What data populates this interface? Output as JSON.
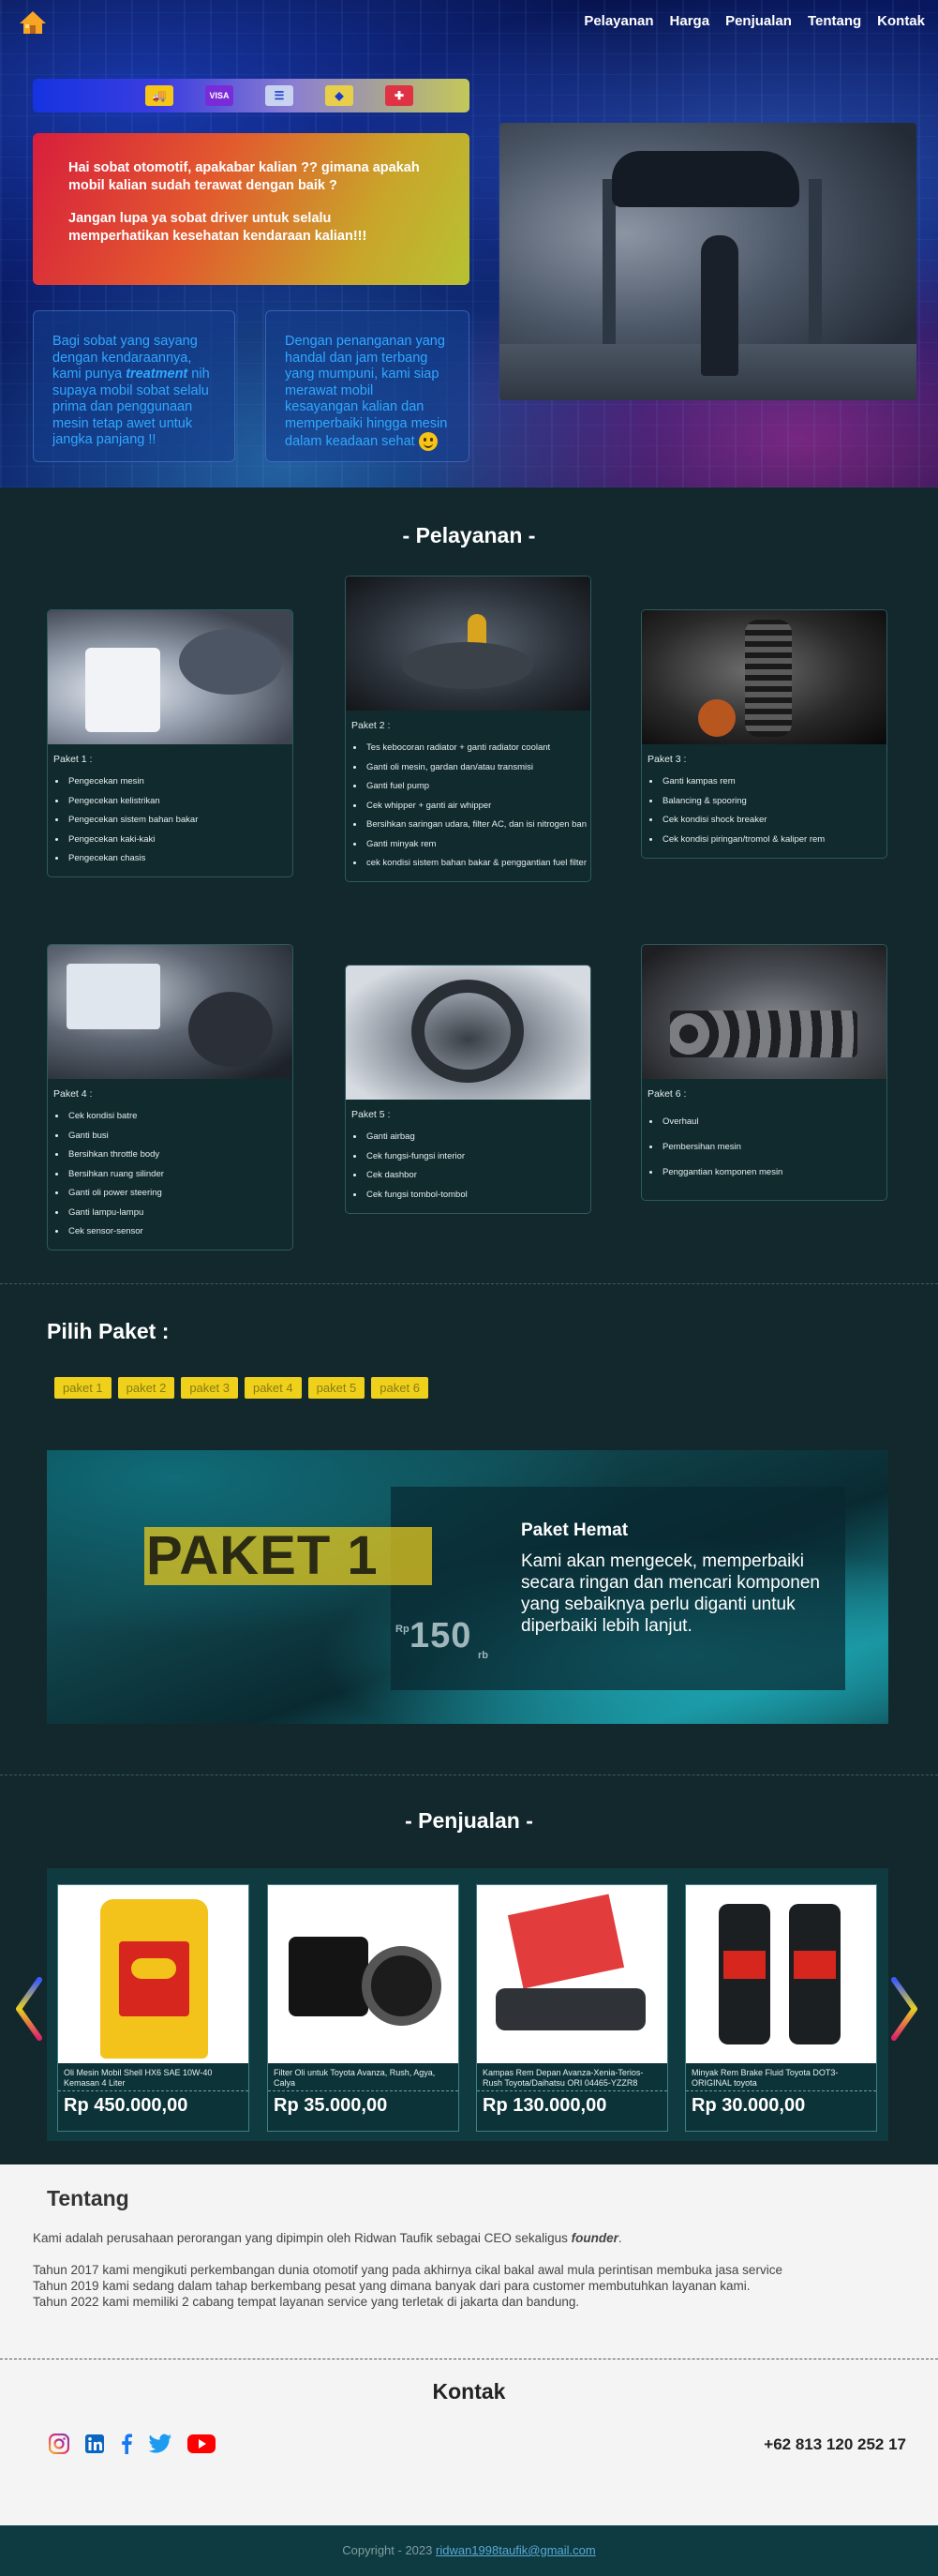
{
  "nav": {
    "links": [
      "Pelayanan",
      "Harga",
      "Penjualan",
      "Tentang",
      "Kontak"
    ]
  },
  "hero": {
    "iconbar": [
      "truck-icon",
      "visa-card-icon",
      "invoice-icon",
      "tag-icon",
      "pin-icon"
    ],
    "greeting_1": "Hai sobat otomotif, apakabar kalian ?? gimana apakah mobil kalian sudah terawat dengan baik ?",
    "greeting_2": "Jangan lupa ya sobat driver untuk selalu memperhatikan kesehatan kendaraan kalian!!!",
    "info_left_pre": "Bagi sobat yang sayang dengan kendaraannya, kami punya ",
    "info_left_em": "treatment",
    "info_left_post": " nih supaya mobil sobat selalu prima dan penggunaan mesin tetap awet untuk jangka panjang !!",
    "info_right": "Dengan penanganan yang handal dan jam terbang yang mumpuni, kami siap merawat mobil kesayangan kalian dan memperbaiki hingga mesin dalam keadaan sehat"
  },
  "pelayanan": {
    "title": "- Pelayanan -",
    "cards": [
      {
        "label": "Paket 1 :",
        "items": [
          "Pengecekan mesin",
          "Pengecekan kelistrikan",
          "Pengecekan sistem bahan bakar",
          "Pengecekan kaki-kaki",
          "Pengecekan chasis"
        ]
      },
      {
        "label": "Paket 2 :",
        "items": [
          "Tes kebocoran radiator + ganti radiator coolant",
          "Ganti oli mesin, gardan dan/atau transmisi",
          "Ganti fuel pump",
          "Cek whipper + ganti air whipper",
          "Bersihkan saringan udara, filter AC, dan isi nitrogen ban",
          "Ganti minyak rem",
          "cek kondisi sistem bahan bakar & penggantian fuel filter"
        ]
      },
      {
        "label": "Paket 3 :",
        "items": [
          "Ganti kampas rem",
          "Balancing & spooring",
          "Cek kondisi shock breaker",
          "Cek kondisi piringan/tromol & kaliper rem"
        ]
      },
      {
        "label": "Paket 4 :",
        "items": [
          "Cek kondisi batre",
          "Ganti busi",
          "Bersihkan throttle body",
          "Bersihkan ruang silinder",
          "Ganti oli power steering",
          "Ganti lampu-lampu",
          "Cek sensor-sensor"
        ]
      },
      {
        "label": "Paket 5 :",
        "items": [
          "Ganti airbag",
          "Cek fungsi-fungsi interior",
          "Cek dashbor",
          "Cek fungsi tombol-tombol"
        ]
      },
      {
        "label": "Paket 6 :",
        "items": [
          "Overhaul",
          "Pembersihan mesin",
          "Penggantian komponen mesin"
        ]
      }
    ]
  },
  "paket": {
    "heading": "Pilih Paket :",
    "tabs": [
      "paket 1",
      "paket 2",
      "paket 3",
      "paket 4",
      "paket 5",
      "paket 6"
    ],
    "name": "PAKET 1",
    "price_prefix": "Rp",
    "price": "150",
    "price_suffix": "rb",
    "title": "Paket Hemat",
    "desc": "Kami akan mengecek, memperbaiki secara ringan dan mencari komponen yang sebaiknya perlu diganti untuk diperbaiki lebih lanjut."
  },
  "penjualan": {
    "title": "- Penjualan -",
    "products": [
      {
        "name": "Oli Mesin Mobil Shell HX6 SAE 10W-40 Kemasan 4 Liter",
        "price": "Rp 450.000,00"
      },
      {
        "name": "Filter Oli untuk Toyota Avanza, Rush, Agya, Calya",
        "price": "Rp 35.000,00"
      },
      {
        "name": "Kampas Rem Depan Avanza-Xenia-Terios-Rush Toyota/Daihatsu ORI 04465-YZZR8",
        "price": "Rp 130.000,00"
      },
      {
        "name": "Minyak Rem Brake Fluid Toyota DOT3-ORIGINAL toyota",
        "price": "Rp 30.000,00"
      }
    ]
  },
  "tentang": {
    "title": "Tentang",
    "p1_pre": "Kami adalah perusahaan perorangan yang dipimpin oleh Ridwan Taufik sebagai CEO sekaligus ",
    "p1_em": "founder",
    "p1_post": ".",
    "p2": "Tahun 2017 kami mengikuti perkembangan dunia otomotif yang pada akhirnya cikal bakal awal mula perintisan membuka jasa service",
    "p3": "Tahun 2019 kami sedang dalam tahap berkembang pesat yang dimana banyak dari para customer membutuhkan layanan kami.",
    "p4": "Tahun 2022 kami memiliki 2 cabang tempat layanan service yang terletak di jakarta dan bandung."
  },
  "kontak": {
    "title": "Kontak",
    "socials": [
      "instagram-icon",
      "linkedin-icon",
      "facebook-icon",
      "twitter-icon",
      "youtube-icon"
    ],
    "phone": "+62 813 120 252 17"
  },
  "footer": {
    "copyright": "Copyright - 2023",
    "email": "ridwan1998taufik@gmail.com"
  },
  "colors": {
    "background": "#12282d",
    "accent_yellow": "#efd11b",
    "teal_panel": "#0f3a40"
  }
}
